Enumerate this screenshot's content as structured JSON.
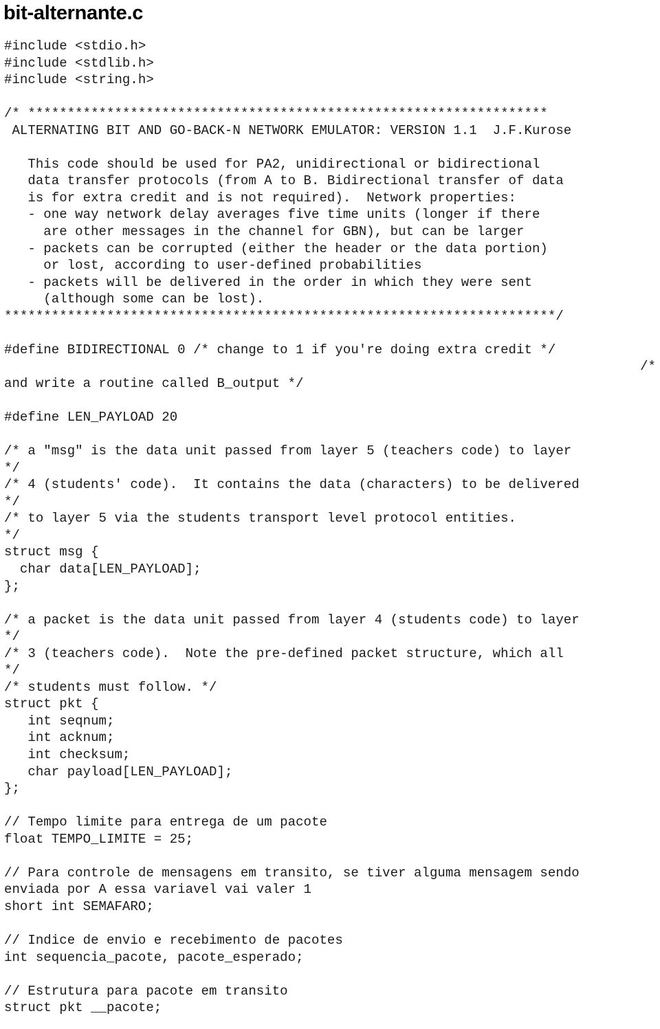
{
  "document": {
    "title": "bit-alternante.c",
    "language": "c",
    "code_lines": [
      "#include <stdio.h>",
      "#include <stdlib.h>",
      "#include <string.h>",
      "",
      "/* ******************************************************************",
      " ALTERNATING BIT AND GO-BACK-N NETWORK EMULATOR: VERSION 1.1  J.F.Kurose",
      "",
      "   This code should be used for PA2, unidirectional or bidirectional",
      "   data transfer protocols (from A to B. Bidirectional transfer of data",
      "   is for extra credit and is not required).  Network properties:",
      "   - one way network delay averages five time units (longer if there",
      "     are other messages in the channel for GBN), but can be larger",
      "   - packets can be corrupted (either the header or the data portion)",
      "     or lost, according to user-defined probabilities",
      "   - packets will be delivered in the order in which they were sent",
      "     (although some can be lost).",
      "**********************************************************************/",
      "",
      "#define BIDIRECTIONAL 0 /* change to 1 if you're doing extra credit */",
      "/*",
      "and write a routine called B_output */",
      "",
      "#define LEN_PAYLOAD 20",
      "",
      "/* a \"msg\" is the data unit passed from layer 5 (teachers code) to layer",
      "*/",
      "/* 4 (students' code).  It contains the data (characters) to be delivered",
      "*/",
      "/* to layer 5 via the students transport level protocol entities.",
      "*/",
      "struct msg {",
      "  char data[LEN_PAYLOAD];",
      "};",
      "",
      "/* a packet is the data unit passed from layer 4 (students code) to layer",
      "*/",
      "/* 3 (teachers code).  Note the pre-defined packet structure, which all",
      "*/",
      "/* students must follow. */",
      "struct pkt {",
      "   int seqnum;",
      "   int acknum;",
      "   int checksum;",
      "   char payload[LEN_PAYLOAD];",
      "};",
      "",
      "// Tempo limite para entrega de um pacote",
      "float TEMPO_LIMITE = 25;",
      "",
      "// Para controle de mensagens em transito, se tiver alguma mensagem sendo",
      "enviada por A essa variavel vai valer 1",
      "short int SEMAFARO;",
      "",
      "// Indice de envio e recebimento de pacotes",
      "int sequencia_pacote, pacote_esperado;",
      "",
      "// Estrutura para pacote em transito",
      "struct pkt __pacote;"
    ],
    "right_aligned_lines": {
      "19": true
    },
    "colors": {
      "background": "#ffffff",
      "title": "#000000",
      "code": "#1a1a1a"
    }
  }
}
